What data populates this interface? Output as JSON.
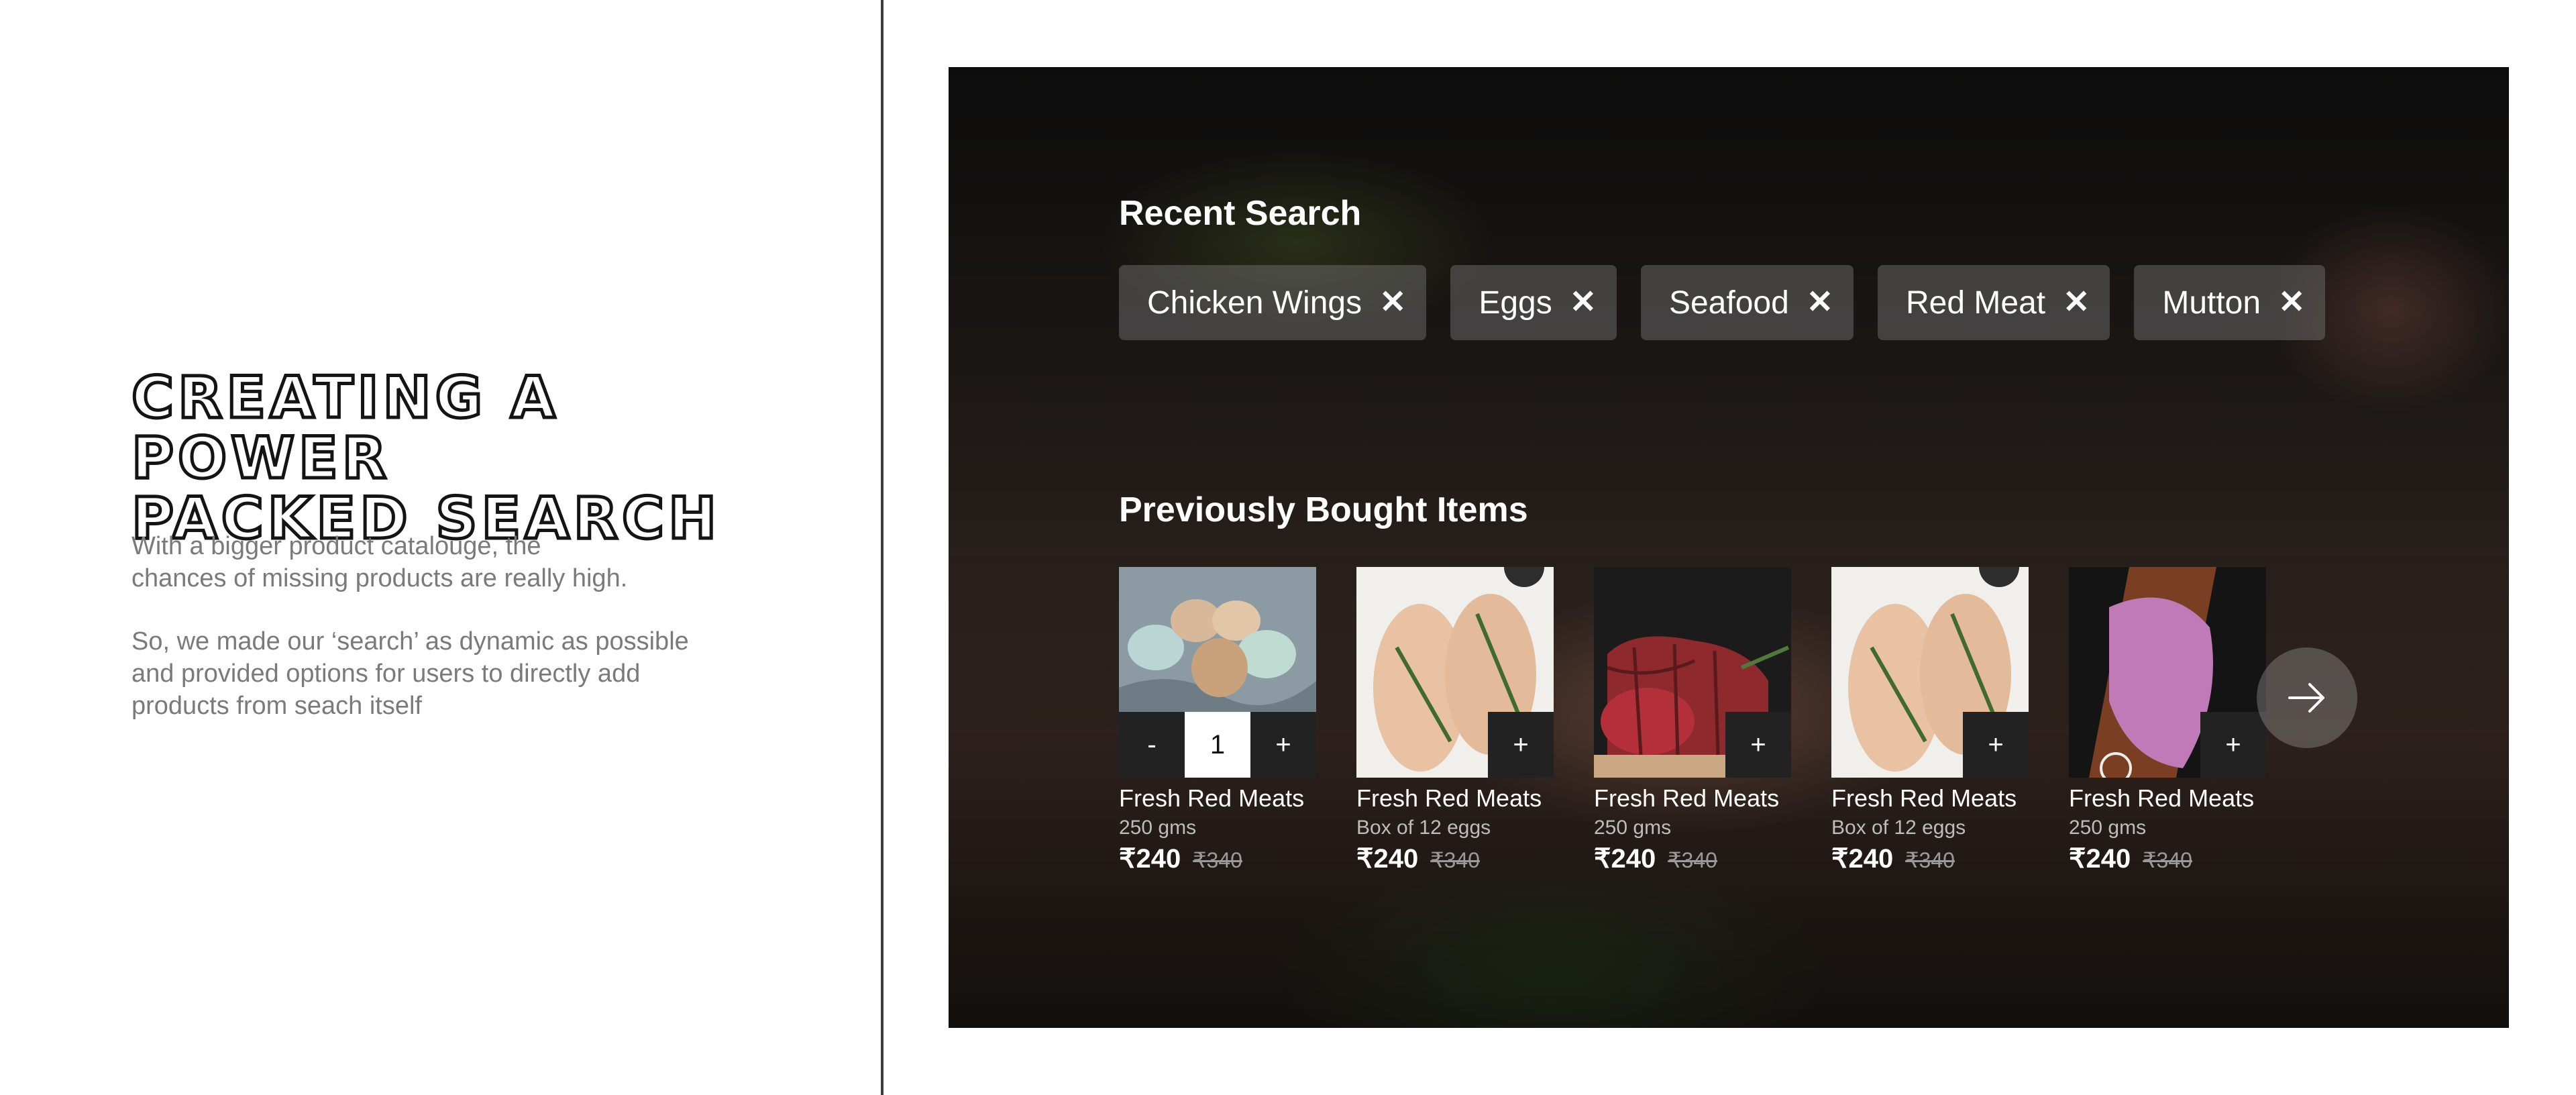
{
  "left": {
    "headline": [
      "CREATING A POWER",
      "PACKED SEARCH"
    ],
    "paragraph1": [
      "With a bigger product catalouge, the",
      "chances of missing products are really high."
    ],
    "paragraph2": [
      "So, we made our ‘search’ as dynamic as possible",
      "and provided options for users to directly add",
      "products from seach itself"
    ]
  },
  "recent_search": {
    "title": "Recent Search",
    "chips": [
      {
        "label": "Chicken Wings",
        "icon": "close-icon"
      },
      {
        "label": "Eggs",
        "icon": "close-icon"
      },
      {
        "label": "Seafood",
        "icon": "close-icon"
      },
      {
        "label": "Red Meat",
        "icon": "close-icon"
      },
      {
        "label": "Mutton",
        "icon": "close-icon"
      }
    ],
    "close_glyph": "✕"
  },
  "previously_bought": {
    "title": "Previously Bought Items",
    "items": [
      {
        "name": "Fresh Red Meats",
        "sub": "250 gms",
        "price": "₹240",
        "was": "₹340",
        "image": "eggs",
        "control": "stepper",
        "qty": "1",
        "minus": "-",
        "plus": "+"
      },
      {
        "name": "Fresh Red Meats",
        "sub": "Box of 12 eggs",
        "price": "₹240",
        "was": "₹340",
        "image": "chicken-breast",
        "control": "add",
        "plus": "+"
      },
      {
        "name": "Fresh Red Meats",
        "sub": "250 gms",
        "price": "₹240",
        "was": "₹340",
        "image": "red-meat",
        "control": "add",
        "plus": "+"
      },
      {
        "name": "Fresh Red Meats",
        "sub": "Box of 12 eggs",
        "price": "₹240",
        "was": "₹340",
        "image": "chicken-breast",
        "control": "add",
        "plus": "+"
      },
      {
        "name": "Fresh Red Meats",
        "sub": "250 gms",
        "price": "₹240",
        "was": "₹340",
        "image": "duck-meat",
        "control": "add",
        "plus": "+"
      }
    ],
    "next_icon": "arrow-right-icon"
  },
  "colors": {
    "accent_dark": "#222222",
    "chip_bg": "rgba(120,120,120,0.45)",
    "text_muted": "#7a7a7a"
  }
}
